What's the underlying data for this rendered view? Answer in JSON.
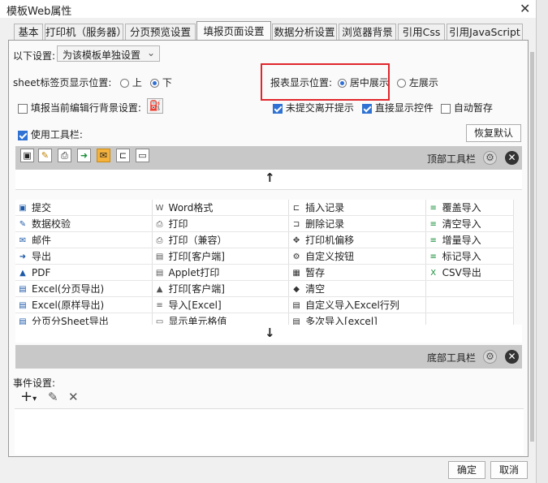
{
  "window": {
    "title": "模板Web属性"
  },
  "tabs": [
    "基本",
    "打印机（服务器）",
    "分页预览设置",
    "填报页面设置",
    "数据分析设置",
    "浏览器背景",
    "引用Css",
    "引用JavaScript"
  ],
  "settings": {
    "scope_label": "以下设置:",
    "scope_value": "为该模板单独设置",
    "sheet_pos_label": "sheet标签页显示位置:",
    "sheet_top": "上",
    "sheet_bottom": "下",
    "report_pos_label": "报表显示位置:",
    "report_center": "居中展示",
    "report_left": "左展示",
    "fill_bg_label": "填报当前编辑行背景设置:",
    "unsubmitted_label": "未提交离开提示",
    "direct_show_label": "直接显示控件",
    "autosave_label": "自动暂存",
    "use_toolbar_label": "使用工具栏:",
    "restore_default": "恢复默认"
  },
  "toolbar": {
    "top_label": "顶部工具栏",
    "bottom_label": "底部工具栏",
    "up_arrow": "↑",
    "down_arrow": "↓",
    "gear_icon": "⚙",
    "close_icon": "✕"
  },
  "tool_items": [
    [
      "提交",
      "Word格式",
      "插入记录",
      "覆盖导入"
    ],
    [
      "数据校验",
      "打印",
      "删除记录",
      "清空导入"
    ],
    [
      "邮件",
      "打印（兼容）",
      "打印机偏移",
      "增量导入"
    ],
    [
      "导出",
      "打印[客户端]",
      "自定义按钮",
      "标记导入"
    ],
    [
      "PDF",
      "Applet打印",
      "暂存",
      "CSV导出"
    ],
    [
      "Excel(分页导出)",
      "打印[客户端]",
      "清空",
      ""
    ],
    [
      "Excel(原样导出)",
      "导入[Excel]",
      "自定义导入Excel行列",
      ""
    ],
    [
      "分页分Sheet导出",
      "显示单元格值",
      "多次导入[excel]",
      ""
    ]
  ],
  "events": {
    "label": "事件设置:",
    "add": "+",
    "add_arrow": "▾",
    "edit": "✎",
    "delete": "✕"
  },
  "footer": {
    "ok": "确定",
    "cancel": "取消"
  },
  "colors": {
    "highlight": "#e0262c",
    "accent": "#2f72d3"
  }
}
